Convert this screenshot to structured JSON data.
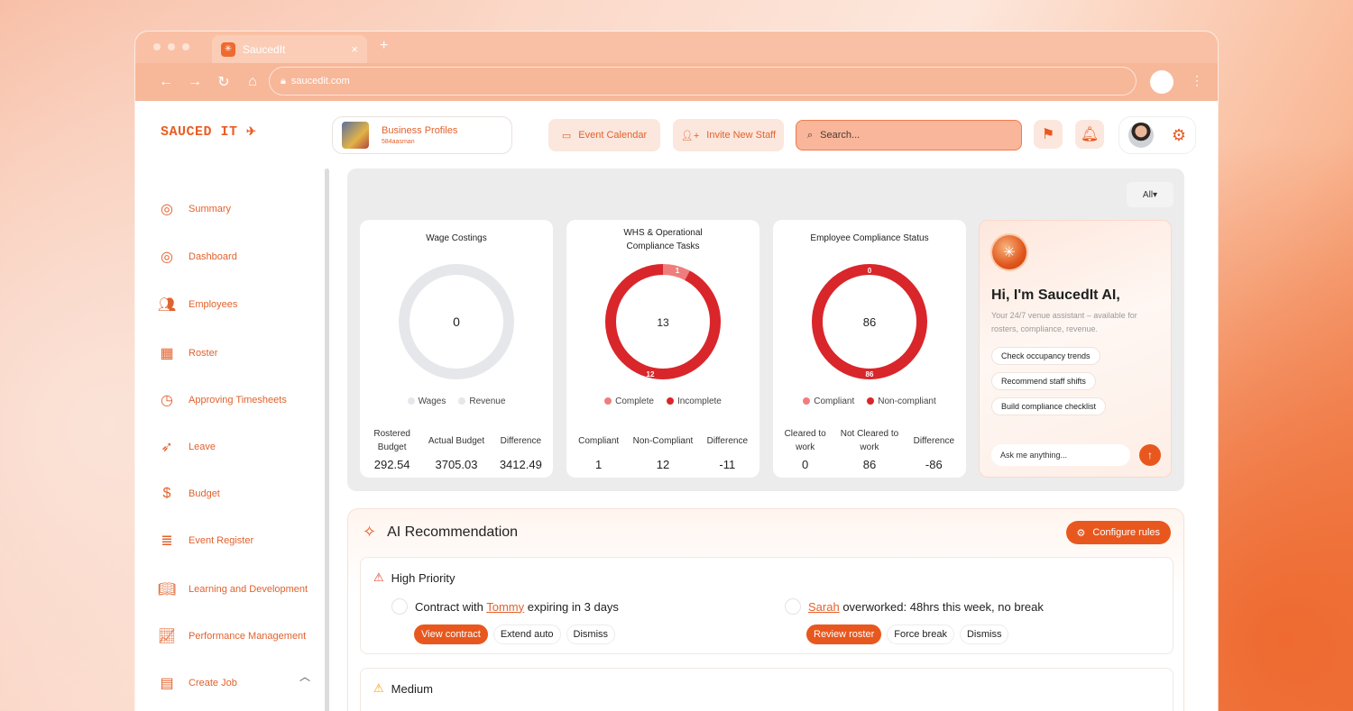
{
  "browser": {
    "tab_title": "SaucedIt",
    "url": "saucedit.com"
  },
  "header": {
    "logo_text": "SAUCED IT",
    "business": {
      "title": "Business Profiles",
      "subtitle": "584aasman"
    },
    "event_calendar": "Event Calendar",
    "invite_staff": "Invite New Staff",
    "search_placeholder": "Search..."
  },
  "sidebar": {
    "items": [
      {
        "label": "Summary",
        "icon": "globe-icon"
      },
      {
        "label": "Dashboard",
        "icon": "globe-icon"
      },
      {
        "label": "Employees",
        "icon": "users-icon"
      },
      {
        "label": "Roster",
        "icon": "calendar-icon"
      },
      {
        "label": "Approving Timesheets",
        "icon": "clock-icon"
      },
      {
        "label": "Leave",
        "icon": "rocket-icon"
      },
      {
        "label": "Budget",
        "icon": "dollar-icon"
      },
      {
        "label": "Event Register",
        "icon": "list-icon"
      },
      {
        "label": "Learning and Development",
        "icon": "book-icon"
      },
      {
        "label": "Performance Management",
        "icon": "chart-icon"
      },
      {
        "label": "Create Job",
        "icon": "document-icon"
      }
    ]
  },
  "filter": {
    "selected": "All"
  },
  "cards": [
    {
      "title": "Wage Costings",
      "center": "0",
      "legend": [
        "Wages",
        "Revenue"
      ],
      "stats": [
        {
          "label": "Rostered Budget",
          "value": "292.54"
        },
        {
          "label": "Actual Budget",
          "value": "3705.03"
        },
        {
          "label": "Difference",
          "value": "3412.49"
        }
      ]
    },
    {
      "title": "WHS & Operational Compliance Tasks",
      "center": "13",
      "top_label": "1",
      "bottom_label": "12",
      "legend": [
        "Complete",
        "Incomplete"
      ],
      "stats": [
        {
          "label": "Compliant",
          "value": "1"
        },
        {
          "label": "Non-Compliant",
          "value": "12"
        },
        {
          "label": "Difference",
          "value": "-11"
        }
      ]
    },
    {
      "title": "Employee Compliance Status",
      "center": "86",
      "top_label": "0",
      "bottom_label": "86",
      "legend": [
        "Compliant",
        "Non-compliant"
      ],
      "stats": [
        {
          "label": "Cleared to work",
          "value": "0"
        },
        {
          "label": "Not Cleared to work",
          "value": "86"
        },
        {
          "label": "Difference",
          "value": "-86"
        }
      ]
    }
  ],
  "assistant": {
    "title": "Hi, I'm SaucedIt AI,",
    "subtitle": "Your 24/7 venue assistant – available for rosters, compliance, revenue.",
    "chips": [
      "Check occupancy trends",
      "Recommend staff shifts",
      "Build compliance checklist"
    ],
    "input_placeholder": "Ask me anything..."
  },
  "recommendation": {
    "title": "AI Recommendation",
    "configure": "Configure rules",
    "high": {
      "label": "High Priority",
      "task1": {
        "pre": "Contract with ",
        "name": "Tommy",
        "post": " expiring in 3 days",
        "actions": [
          "View contract",
          "Extend auto",
          "Dismiss"
        ]
      },
      "task2": {
        "name": "Sarah",
        "post": " overworked: 48hrs this week, no break",
        "actions": [
          "Review roster",
          "Force break",
          "Dismiss"
        ]
      }
    },
    "medium": {
      "label": "Medium"
    }
  },
  "colors": {
    "accent": "#e8581e",
    "red": "#d9262b",
    "pink": "#f07d7d",
    "grey": "#e5e7eb"
  }
}
